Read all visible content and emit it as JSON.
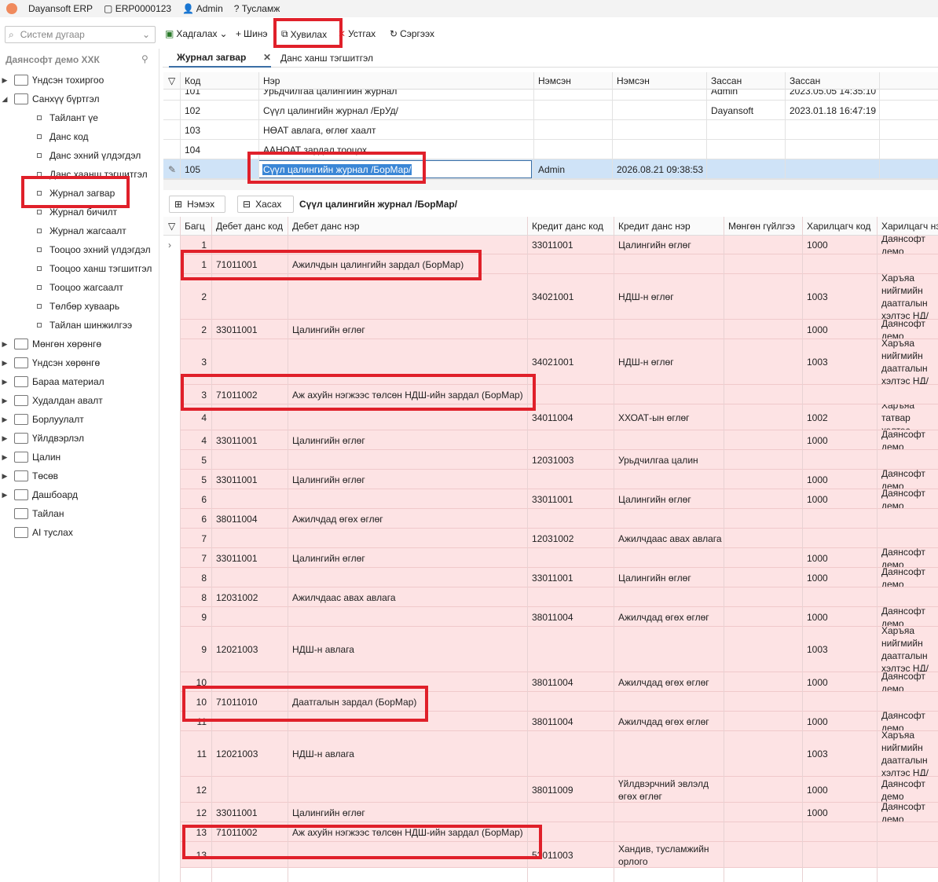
{
  "titlebar": {
    "app": "Dayansoft ERP",
    "doc": "ERP0000123",
    "user": "Admin",
    "help": "Тусламж"
  },
  "toolbar": {
    "system_number_placeholder": "Систем дугаар",
    "save": "Хадгалах",
    "new": "Шинэ",
    "copy": "Хувилах",
    "delete": "Устгах",
    "refresh": "Сэргээх"
  },
  "sidebar": {
    "company": "Даянсофт демо ХХК",
    "items": [
      {
        "label": "Үндсэн тохиргоо",
        "level": 0,
        "icon": "gear-icon"
      },
      {
        "label": "Санхүү бүртгэл",
        "level": 0,
        "icon": "ledger-icon",
        "expanded": true
      },
      {
        "label": "Тайлант үе",
        "level": 1
      },
      {
        "label": "Данс код",
        "level": 1
      },
      {
        "label": "Данс эхний үлдэгдэл",
        "level": 1
      },
      {
        "label": "Данс хаанш тэгшитгэл",
        "level": 1
      },
      {
        "label": "Журнал загвар",
        "level": 1,
        "selected": true
      },
      {
        "label": "Журнал бичилт",
        "level": 1
      },
      {
        "label": "Журнал жагсаалт",
        "level": 1
      },
      {
        "label": "Тооцоо эхний үлдэгдэл",
        "level": 1
      },
      {
        "label": "Тооцоо ханш тэгшитгэл",
        "level": 1
      },
      {
        "label": "Тооцоо жагсаалт",
        "level": 1
      },
      {
        "label": "Төлбөр хуваарь",
        "level": 1
      },
      {
        "label": "Тайлан шинжилгээ",
        "level": 1
      },
      {
        "label": "Мөнгөн хөрөнгө",
        "level": 0,
        "icon": "cash-icon"
      },
      {
        "label": "Үндсэн хөрөнгө",
        "level": 0,
        "icon": "building-icon"
      },
      {
        "label": "Бараа материал",
        "level": 0,
        "icon": "box-icon"
      },
      {
        "label": "Худалдан авалт",
        "level": 0,
        "icon": "purchase-icon"
      },
      {
        "label": "Борлуулалт",
        "level": 0,
        "icon": "cart-icon"
      },
      {
        "label": "Үйлдвэрлэл",
        "level": 0,
        "icon": "factory-icon"
      },
      {
        "label": "Цалин",
        "level": 0,
        "icon": "calculator-icon"
      },
      {
        "label": "Төсөв",
        "level": 0,
        "icon": "pie-icon"
      },
      {
        "label": "Дашбоард",
        "level": 0,
        "icon": "dashboard-icon"
      },
      {
        "label": "Тайлан",
        "level": 0,
        "icon": "report-icon",
        "leaf": true
      },
      {
        "label": "AI туслах",
        "level": 0,
        "icon": "ai-icon",
        "leaf": true
      }
    ]
  },
  "tabs": [
    {
      "label": "Журнал загвар",
      "active": true
    },
    {
      "label": "Данс ханш тэгшитгэл",
      "active": false
    }
  ],
  "top_grid": {
    "headers": [
      "Код",
      "Нэр",
      "Нэмсэн",
      "Нэмсэн",
      "Зассан",
      "Зассан"
    ],
    "rows": [
      [
        "101",
        "Урьдчилгаа цалингийн журнал",
        "",
        "",
        "Admin",
        "2023.05.05 14:35:10"
      ],
      [
        "102",
        "Сүүл цалингийн журнал /ЕрУд/",
        "",
        "",
        "Dayansoft",
        "2023.01.18 16:47:19"
      ],
      [
        "103",
        "НӨАТ авлага, өглөг хаалт",
        "",
        "",
        "",
        ""
      ],
      [
        "104",
        "ААНОАТ зардал тооцох",
        "",
        "",
        "",
        ""
      ],
      [
        "105",
        "Сүүл цалингийн журнал /БорМар/",
        "Admin",
        "2026.08.21 09:38:53",
        "",
        ""
      ]
    ]
  },
  "detail": {
    "add": "Нэмэх",
    "remove": "Хасах",
    "title": "Сүүл цалингийн журнал /БорМар/",
    "headers": [
      "Багц",
      "Дебет данс код",
      "Дебет данс нэр",
      "Кредит данс код",
      "Кредит данс нэр",
      "Мөнгөн гүйлгээ",
      "Харилцагч код",
      "Харилцагч нэр"
    ],
    "rows": [
      [
        "1",
        "",
        "",
        "33011001",
        "Цалингийн өглөг",
        "",
        "1000",
        "Даянсофт демо"
      ],
      [
        "1",
        "71011001",
        "Ажилчдын цалингийн зардал (БорМар)",
        "",
        "",
        "",
        "",
        ""
      ],
      [
        "2",
        "",
        "",
        "34021001",
        "НДШ-н өглөг",
        "",
        "1003",
        "Харъяа нийгмийн даатгалын хэлтэс НД/"
      ],
      [
        "2",
        "33011001",
        "Цалингийн өглөг",
        "",
        "",
        "",
        "1000",
        "Даянсофт демо"
      ],
      [
        "3",
        "",
        "",
        "34021001",
        "НДШ-н өглөг",
        "",
        "1003",
        "Харъяа нийгмийн даатгалын хэлтэс НД/"
      ],
      [
        "3",
        "71011002",
        "Аж ахуйн нэгжээс төлсөн НДШ-ийн зардал (БорМар)",
        "",
        "",
        "",
        "",
        ""
      ],
      [
        "4",
        "",
        "",
        "34011004",
        "ХХОАТ-ын өглөг",
        "",
        "1002",
        "Харъяа татвар хэлтэс"
      ],
      [
        "4",
        "33011001",
        "Цалингийн өглөг",
        "",
        "",
        "",
        "1000",
        "Даянсофт демо"
      ],
      [
        "5",
        "",
        "",
        "12031003",
        "Урьдчилгаа цалин",
        "",
        "",
        ""
      ],
      [
        "5",
        "33011001",
        "Цалингийн өглөг",
        "",
        "",
        "",
        "1000",
        "Даянсофт демо"
      ],
      [
        "6",
        "",
        "",
        "33011001",
        "Цалингийн өглөг",
        "",
        "1000",
        "Даянсофт демо"
      ],
      [
        "6",
        "38011004",
        "Ажилчдад өгөх өглөг",
        "",
        "",
        "",
        "",
        ""
      ],
      [
        "7",
        "",
        "",
        "12031002",
        "Ажилчдаас авах авлага",
        "",
        "",
        ""
      ],
      [
        "7",
        "33011001",
        "Цалингийн өглөг",
        "",
        "",
        "",
        "1000",
        "Даянсофт демо"
      ],
      [
        "8",
        "",
        "",
        "33011001",
        "Цалингийн өглөг",
        "",
        "1000",
        "Даянсофт демо"
      ],
      [
        "8",
        "12031002",
        "Ажилчдаас авах авлага",
        "",
        "",
        "",
        "",
        ""
      ],
      [
        "9",
        "",
        "",
        "38011004",
        "Ажилчдад өгөх өглөг",
        "",
        "1000",
        "Даянсофт демо"
      ],
      [
        "9",
        "12021003",
        "НДШ-н авлага",
        "",
        "",
        "",
        "1003",
        "Харъяа нийгмийн даатгалын хэлтэс НД/"
      ],
      [
        "10",
        "",
        "",
        "38011004",
        "Ажилчдад өгөх өглөг",
        "",
        "1000",
        "Даянсофт демо"
      ],
      [
        "10",
        "71011010",
        "Даатгалын зардал (БорМар)",
        "",
        "",
        "",
        "",
        ""
      ],
      [
        "11",
        "",
        "",
        "38011004",
        "Ажилчдад өгөх өглөг",
        "",
        "1000",
        "Даянсофт демо"
      ],
      [
        "11",
        "12021003",
        "НДШ-н авлага",
        "",
        "",
        "",
        "1003",
        "Харъяа нийгмийн даатгалын хэлтэс НД/"
      ],
      [
        "12",
        "",
        "",
        "38011009",
        "Үйлдвэрчний эвлэлд өгөх өглөг",
        "",
        "1000",
        "Даянсофт демо"
      ],
      [
        "12",
        "33011001",
        "Цалингийн өглөг",
        "",
        "",
        "",
        "1000",
        "Даянсофт демо"
      ],
      [
        "13",
        "71011002",
        "Аж ахуйн нэгжээс төлсөн НДШ-ийн зардал (БорМар)",
        "",
        "",
        "",
        "",
        ""
      ],
      [
        "13",
        "",
        "",
        "52011003",
        "Хандив, тусламжийн орлого",
        "",
        "",
        ""
      ]
    ]
  }
}
